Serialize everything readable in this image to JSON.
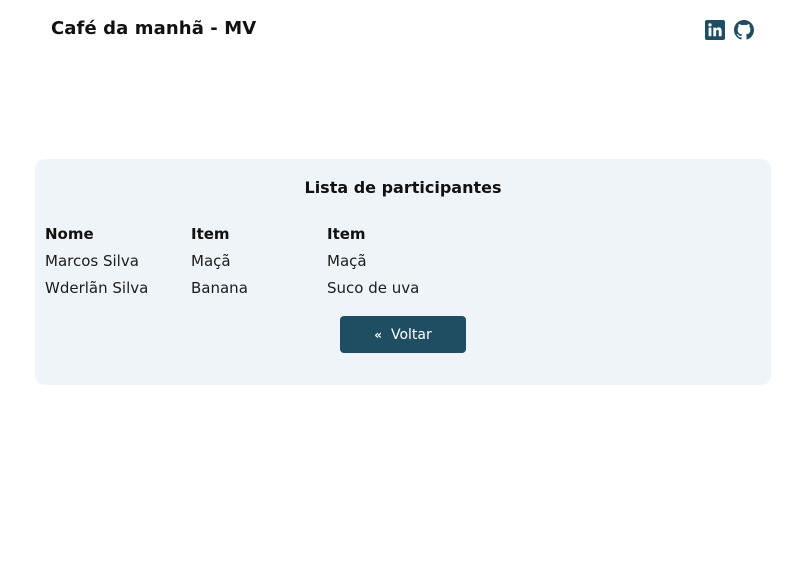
{
  "header": {
    "brand_title": "Café da manhã - MV",
    "social": [
      {
        "icon": "linkedin-icon",
        "color": "#1f4e63"
      },
      {
        "icon": "github-icon",
        "color": "#1f4e63"
      }
    ]
  },
  "card": {
    "title": "Lista de participantes",
    "columns": [
      "Nome",
      "Item",
      "Item"
    ],
    "rows": [
      [
        "Marcos Silva",
        "Maçã",
        "Maçã"
      ],
      [
        "Wderlãn Silva",
        "Banana",
        "Suco de uva"
      ]
    ],
    "back_button": {
      "icon": "«",
      "label": "Voltar"
    }
  },
  "colors": {
    "accent": "#1f4e63",
    "card_background": "#eef4f8"
  }
}
